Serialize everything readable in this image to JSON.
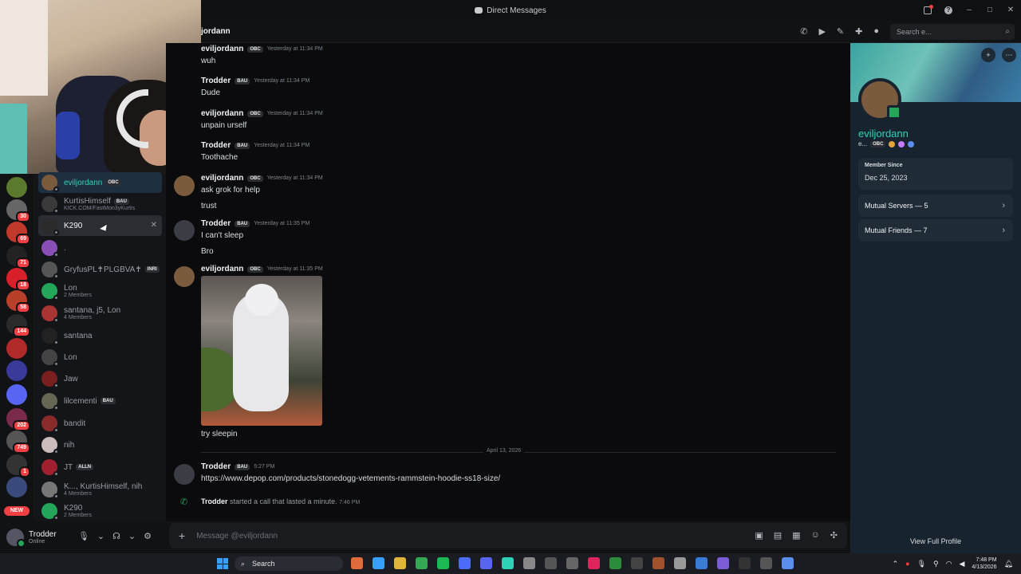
{
  "window": {
    "title": "Direct Messages"
  },
  "channel": {
    "name": "jordann",
    "search_placeholder": "Search e..."
  },
  "dms": [
    {
      "name": "eviljordann",
      "tag": "OBC",
      "sub": "",
      "color": "#7a5b3e"
    },
    {
      "name": "KurtisHimself",
      "tag": "BAU",
      "sub": "KICK.COM/FastMon3yKurtis",
      "color": "#3a3a3a"
    },
    {
      "name": "K290",
      "tag": "",
      "sub": "",
      "color": "#2b2b2b"
    },
    {
      "name": ".",
      "tag": "",
      "sub": "",
      "color": "#8a4fb7"
    },
    {
      "name": "GryfusPL✝PLGBVA✝",
      "tag": "INRI",
      "sub": "",
      "color": "#555"
    },
    {
      "name": "Lon",
      "tag": "",
      "sub": "2 Members",
      "color": "#23a55a"
    },
    {
      "name": "santana, j5, Lon",
      "tag": "",
      "sub": "4 Members",
      "color": "#a33"
    },
    {
      "name": "santana",
      "tag": "",
      "sub": "",
      "color": "#222"
    },
    {
      "name": "Lon",
      "tag": "",
      "sub": "",
      "color": "#444"
    },
    {
      "name": "Jaw",
      "tag": "",
      "sub": "",
      "color": "#7a1f1f"
    },
    {
      "name": "lilcementi",
      "tag": "BAU",
      "sub": "",
      "color": "#665"
    },
    {
      "name": "bandit",
      "tag": "",
      "sub": "",
      "color": "#8a2b2b"
    },
    {
      "name": "nih",
      "tag": "",
      "sub": "",
      "color": "#cbb"
    },
    {
      "name": "JT",
      "tag": "ALLN",
      "sub": "",
      "color": "#a02030"
    },
    {
      "name": "K..., KurtisHimself, nih",
      "tag": "",
      "sub": "4 Members",
      "color": "#777"
    },
    {
      "name": "K290",
      "tag": "",
      "sub": "2 Members",
      "color": "#23a55a"
    }
  ],
  "servers": [
    {
      "badge": "",
      "color": "#5b7a2e"
    },
    {
      "badge": "30",
      "color": "#666"
    },
    {
      "badge": "69",
      "color": "#c0392b"
    },
    {
      "badge": "71",
      "color": "#222"
    },
    {
      "badge": "18",
      "color": "#d8202a"
    },
    {
      "badge": "58",
      "color": "#b8402a"
    },
    {
      "badge": "144",
      "color": "#2a2a2a"
    },
    {
      "badge": "",
      "color": "#b02a2a"
    },
    {
      "badge": "",
      "color": "#3a3a9a"
    },
    {
      "badge": "",
      "color": "#5865f2"
    },
    {
      "badge": "202",
      "color": "#7a2a4a"
    },
    {
      "badge": "749",
      "color": "#555"
    },
    {
      "badge": "1",
      "color": "#333"
    },
    {
      "badge": "",
      "color": "#3a4a7a"
    }
  ],
  "new_label": "NEW",
  "user": {
    "name": "Trodder",
    "status": "Online"
  },
  "messages": [
    {
      "author": "eviljordann",
      "tag": "OBC",
      "time": "Yesterday at 11:34 PM",
      "lines": [
        "wuh"
      ]
    },
    {
      "author": "Trodder",
      "tag": "BAU",
      "time": "Yesterday at 11:34 PM",
      "lines": [
        "Dude"
      ]
    },
    {
      "author": "eviljordann",
      "tag": "OBC",
      "time": "Yesterday at 11:34 PM",
      "lines": [
        "unpain urself"
      ]
    },
    {
      "author": "Trodder",
      "tag": "BAU",
      "time": "Yesterday at 11:34 PM",
      "lines": [
        "Toothache"
      ]
    },
    {
      "author": "eviljordann",
      "tag": "OBC",
      "time": "Yesterday at 11:34 PM",
      "lines": [
        "ask grok for help",
        "trust"
      ]
    },
    {
      "author": "Trodder",
      "tag": "BAU",
      "time": "Yesterday at 11:35 PM",
      "lines": [
        "I can't sleep",
        "Bro"
      ]
    },
    {
      "author": "eviljordann",
      "tag": "OBC",
      "time": "Yesterday at 11:35 PM",
      "lines": [
        "try sleepin"
      ]
    },
    {
      "author": "Trodder",
      "tag": "BAU",
      "time": "5:27 PM",
      "lines": [
        "https://www.depop.com/products/stonedogg-vetements-rammstein-hoodie-ss18-size/"
      ]
    }
  ],
  "date_divider": "April 13, 2026",
  "call": {
    "author": "Trodder",
    "text": "started a call that lasted a minute.",
    "time": "7:46 PM"
  },
  "composer": {
    "placeholder": "Message @eviljordann"
  },
  "profile": {
    "name": "eviljordann",
    "tag_prefix": "e...",
    "tag": "OBC",
    "member_since_label": "Member Since",
    "member_since": "Dec 25, 2023",
    "mutual_servers": "Mutual Servers — 5",
    "mutual_friends": "Mutual Friends — 7",
    "view_full": "View Full Profile"
  },
  "taskbar": {
    "search": "Search",
    "time": "7:48 PM",
    "date": "4/13/2026"
  },
  "colors": {
    "accent_teal": "#2ed3b7",
    "link": "#00a8fc",
    "online": "#23a55a",
    "danger": "#f23f43"
  }
}
